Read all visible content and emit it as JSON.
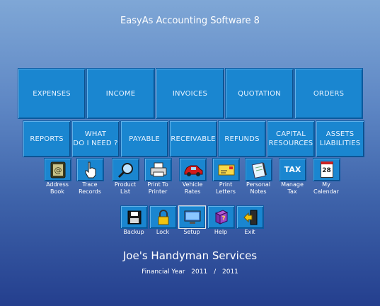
{
  "app": {
    "title": "EasyAs Accounting Software 8"
  },
  "main_buttons": [
    {
      "label": "EXPENSES"
    },
    {
      "label": "INCOME"
    },
    {
      "label": "INVOICES"
    },
    {
      "label": "QUOTATION"
    },
    {
      "label": "ORDERS"
    }
  ],
  "second_buttons": [
    {
      "label": "REPORTS"
    },
    {
      "label": "WHAT\nDO I NEED ?"
    },
    {
      "label": "PAYABLE"
    },
    {
      "label": "RECEIVABLE"
    },
    {
      "label": "REFUNDS"
    },
    {
      "label": "CAPITAL\nRESOURCES"
    },
    {
      "label": "ASSETS\nLIABILITIES"
    }
  ],
  "tools": [
    {
      "label": "Address\nBook",
      "icon": "address-book-icon"
    },
    {
      "label": "Trace\nRecords",
      "icon": "pointing-hand-icon"
    },
    {
      "label": "Product\nList",
      "icon": "magnifier-icon"
    },
    {
      "label": "Print To\nPrinter",
      "icon": "printer-icon"
    },
    {
      "label": "Vehicle\nRates",
      "icon": "car-icon"
    },
    {
      "label": "Print\nLetters",
      "icon": "envelope-icon"
    },
    {
      "label": "Personal\nNotes",
      "icon": "notepad-icon"
    },
    {
      "label": "Manage\nTax",
      "icon": "tax-icon",
      "icon_text": "TAX"
    },
    {
      "label": "My\nCalendar",
      "icon": "calendar-icon",
      "icon_text": "28"
    }
  ],
  "system": [
    {
      "label": "Backup",
      "icon": "floppy-disk-icon"
    },
    {
      "label": "Lock",
      "icon": "padlock-icon"
    },
    {
      "label": "Setup",
      "icon": "monitor-icon"
    },
    {
      "label": "Help",
      "icon": "help-book-icon"
    },
    {
      "label": "Exit",
      "icon": "exit-door-icon"
    }
  ],
  "company": {
    "name": "Joe's Handyman Services"
  },
  "financial_year": {
    "label": "Financial Year",
    "start": "2011",
    "separator": "/",
    "end": "2011"
  },
  "colors": {
    "button_bg": "#1a86d0",
    "button_text": "#e8f3ff"
  }
}
